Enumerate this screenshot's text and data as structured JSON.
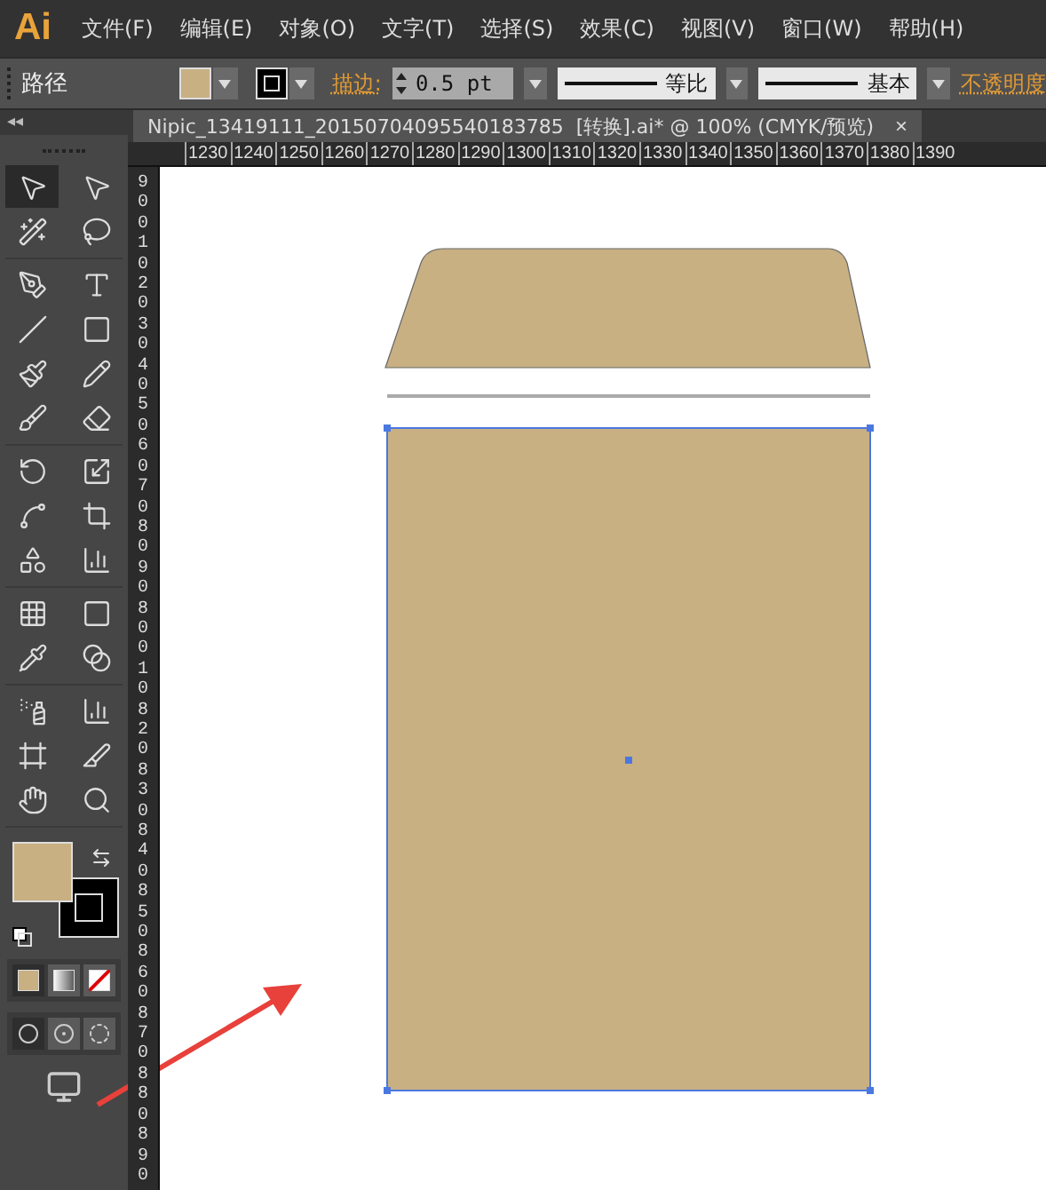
{
  "app_logo": "Ai",
  "menu": [
    "文件(F)",
    "编辑(E)",
    "对象(O)",
    "文字(T)",
    "选择(S)",
    "效果(C)",
    "视图(V)",
    "窗口(W)",
    "帮助(H)"
  ],
  "control_bar": {
    "object_type": "路径",
    "stroke_label": "描边:",
    "stroke_weight": "0.5 pt",
    "profile": "等比",
    "brush": "基本",
    "opacity_label": "不透明度"
  },
  "panel_collapse": "◂◂",
  "document_tab": {
    "title": "Nipic_13419111_20150704095540183785  [转换].ai* @ 100% (CMYK/预览)",
    "close": "×",
    "selected": true
  },
  "ruler_h": [
    "1230",
    "1240",
    "1250",
    "1260",
    "1270",
    "1280",
    "1290",
    "1300",
    "1310",
    "1320",
    "1330",
    "1340",
    "1350",
    "1360",
    "1370",
    "1380",
    "1390"
  ],
  "ruler_v": [
    "9",
    "0",
    "0",
    "1",
    "0",
    "2",
    "0",
    "3",
    "0",
    "4",
    "0",
    "5",
    "0",
    "6",
    "0",
    "7",
    "0",
    "8",
    "0",
    "9",
    "0",
    "8",
    "0",
    "0",
    "1",
    "0",
    "8",
    "2",
    "0",
    "8",
    "3",
    "0",
    "8",
    "4",
    "0",
    "8",
    "5",
    "0",
    "8",
    "6",
    "0",
    "8",
    "7",
    "0",
    "8",
    "8",
    "0",
    "8",
    "9",
    "0"
  ],
  "tool_groups": [
    [
      {
        "kind": "selection",
        "selected": true
      },
      {
        "kind": "direct-selection",
        "selected": false
      },
      {
        "kind": "magic-wand",
        "selected": false
      },
      {
        "kind": "lasso",
        "selected": false
      }
    ],
    [
      {
        "kind": "pen",
        "selected": false
      },
      {
        "kind": "type",
        "selected": false
      },
      {
        "kind": "line",
        "selected": false
      },
      {
        "kind": "rectangle",
        "selected": false
      },
      {
        "kind": "paintbrush",
        "selected": false
      },
      {
        "kind": "pencil",
        "selected": false
      },
      {
        "kind": "blob-brush",
        "selected": false
      },
      {
        "kind": "eraser",
        "selected": false
      }
    ],
    [
      {
        "kind": "rotate",
        "selected": false
      },
      {
        "kind": "scale",
        "selected": false
      },
      {
        "kind": "puppet",
        "selected": false
      },
      {
        "kind": "transform",
        "selected": false
      },
      {
        "kind": "shape-builder",
        "selected": false
      },
      {
        "kind": "perspective",
        "selected": false
      }
    ],
    [
      {
        "kind": "mesh",
        "selected": false
      },
      {
        "kind": "gradient",
        "selected": false
      },
      {
        "kind": "eyedropper",
        "selected": false
      },
      {
        "kind": "blend",
        "selected": false
      }
    ],
    [
      {
        "kind": "spray",
        "selected": false
      },
      {
        "kind": "graph",
        "selected": false
      },
      {
        "kind": "artboard",
        "selected": false
      },
      {
        "kind": "slice",
        "selected": false
      },
      {
        "kind": "hand",
        "selected": false
      },
      {
        "kind": "zoom",
        "selected": false
      }
    ]
  ],
  "color_modes": [
    {
      "kind": "color",
      "selected": true
    },
    {
      "kind": "gradient",
      "selected": false
    },
    {
      "kind": "none",
      "selected": false
    }
  ],
  "draw_modes": [
    {
      "kind": "normal",
      "selected": true
    },
    {
      "kind": "behind",
      "selected": false
    },
    {
      "kind": "inside",
      "selected": false
    }
  ],
  "canvas": {
    "selected_object": true
  }
}
